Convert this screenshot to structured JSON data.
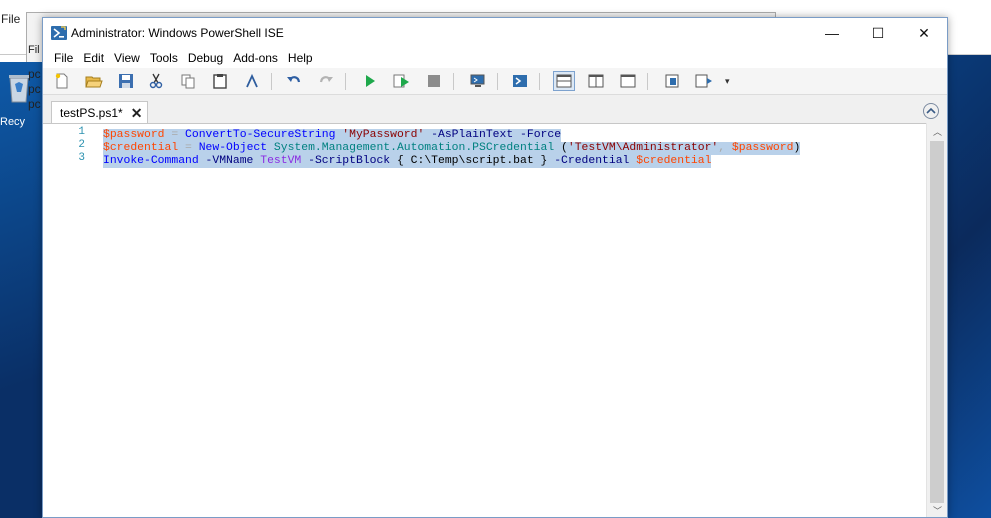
{
  "background": {
    "menu_file": "File",
    "menu_file_short": "Fil",
    "desktop_items": [
      "pc",
      "pc",
      "pc"
    ],
    "recycle_label": "Recy"
  },
  "window": {
    "title": "Administrator: Windows PowerShell ISE",
    "controls": {
      "minimize": "—",
      "maximize": "☐",
      "close": "✕"
    }
  },
  "menubar": {
    "items": [
      "File",
      "Edit",
      "View",
      "Tools",
      "Debug",
      "Add-ons",
      "Help"
    ]
  },
  "toolbar": {
    "icons": [
      "new-icon",
      "open-icon",
      "save-icon",
      "cut-icon",
      "copy-icon",
      "paste-icon",
      "clear-icon",
      "undo-icon",
      "redo-icon",
      "run-icon",
      "run-selection-icon",
      "stop-icon",
      "remote-icon",
      "powershell-icon",
      "layout-top-icon",
      "layout-right-icon",
      "layout-max-icon",
      "show-commands-icon",
      "show-addon-icon"
    ]
  },
  "tabs": [
    {
      "label": "testPS.ps1*",
      "close": "✕"
    }
  ],
  "editor": {
    "line_numbers": [
      "1",
      "2",
      "3"
    ],
    "lines": [
      [
        {
          "t": "var",
          "v": "$password"
        },
        {
          "t": "op",
          "v": " = "
        },
        {
          "t": "cmd",
          "v": "ConvertTo-SecureString"
        },
        {
          "t": "plain",
          "v": " "
        },
        {
          "t": "str",
          "v": "'MyPassword'"
        },
        {
          "t": "plain",
          "v": " "
        },
        {
          "t": "param",
          "v": "-AsPlainText"
        },
        {
          "t": "plain",
          "v": " "
        },
        {
          "t": "param",
          "v": "-Force"
        }
      ],
      [
        {
          "t": "var",
          "v": "$credential"
        },
        {
          "t": "op",
          "v": " = "
        },
        {
          "t": "cmd",
          "v": "New-Object"
        },
        {
          "t": "plain",
          "v": " "
        },
        {
          "t": "type",
          "v": "System.Management.Automation.PSCredential"
        },
        {
          "t": "plain",
          "v": " ("
        },
        {
          "t": "str",
          "v": "'TestVM\\Administrator'"
        },
        {
          "t": "op",
          "v": ", "
        },
        {
          "t": "var",
          "v": "$password"
        },
        {
          "t": "plain",
          "v": ")"
        }
      ],
      [
        {
          "t": "cmd",
          "v": "Invoke-Command"
        },
        {
          "t": "plain",
          "v": " "
        },
        {
          "t": "param",
          "v": "-VMName"
        },
        {
          "t": "plain",
          "v": " "
        },
        {
          "t": "arg",
          "v": "TestVM"
        },
        {
          "t": "plain",
          "v": " "
        },
        {
          "t": "param",
          "v": "-ScriptBlock"
        },
        {
          "t": "plain",
          "v": " { C:\\Temp\\script.bat } "
        },
        {
          "t": "param",
          "v": "-Credential"
        },
        {
          "t": "plain",
          "v": " "
        },
        {
          "t": "var",
          "v": "$credential"
        }
      ]
    ]
  }
}
